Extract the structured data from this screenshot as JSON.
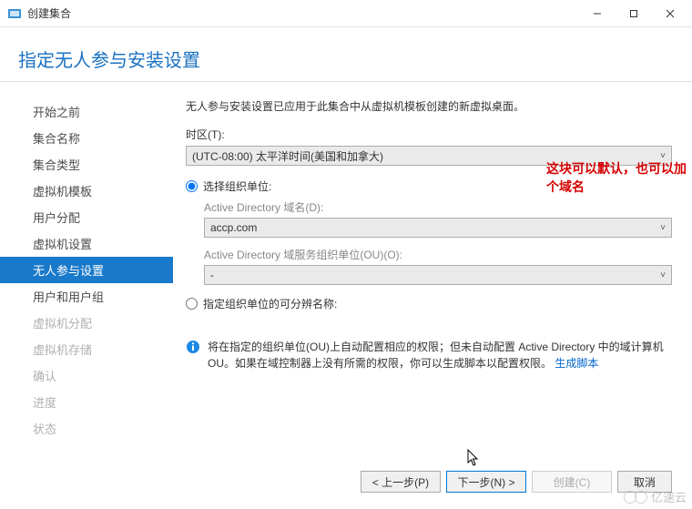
{
  "window": {
    "title": "创建集合"
  },
  "page": {
    "heading": "指定无人参与安装设置",
    "description": "无人参与安装设置已应用于此集合中从虚拟机模板创建的新虚拟桌面。",
    "timezone_label": "时区(T):",
    "timezone_value": "(UTC-08:00) 太平洋时间(美国和加拿大)",
    "radio_select_ou": "选择组织单位:",
    "radio_specify_dn": "指定组织单位的可分辨名称:",
    "ad_domain_label": "Active Directory 域名(D):",
    "ad_domain_value": "accp.com",
    "ad_ou_label": "Active Directory 域服务组织单位(OU)(O):",
    "ad_ou_value": "-",
    "annotation": "这块可以默认，也可以加个域名",
    "info_text_1": "将在指定的组织单位(OU)上自动配置相应的权限；但未自动配置 Active Directory 中的域计算机 OU。如果在域控制器上没有所需的权限，你可以生成脚本以配置权限。",
    "info_link": "生成脚本"
  },
  "sidebar": {
    "items": [
      {
        "label": "开始之前",
        "state": "normal"
      },
      {
        "label": "集合名称",
        "state": "normal"
      },
      {
        "label": "集合类型",
        "state": "normal"
      },
      {
        "label": "虚拟机模板",
        "state": "normal"
      },
      {
        "label": "用户分配",
        "state": "normal"
      },
      {
        "label": "虚拟机设置",
        "state": "normal"
      },
      {
        "label": "无人参与设置",
        "state": "active"
      },
      {
        "label": "用户和用户组",
        "state": "normal"
      },
      {
        "label": "虚拟机分配",
        "state": "dim"
      },
      {
        "label": "虚拟机存储",
        "state": "dim"
      },
      {
        "label": "确认",
        "state": "dim"
      },
      {
        "label": "进度",
        "state": "dim"
      },
      {
        "label": "状态",
        "state": "dim"
      }
    ]
  },
  "footer": {
    "prev": "< 上一步(P)",
    "next": "下一步(N) >",
    "create": "创建(C)",
    "cancel": "取消"
  },
  "watermark": "亿速云"
}
